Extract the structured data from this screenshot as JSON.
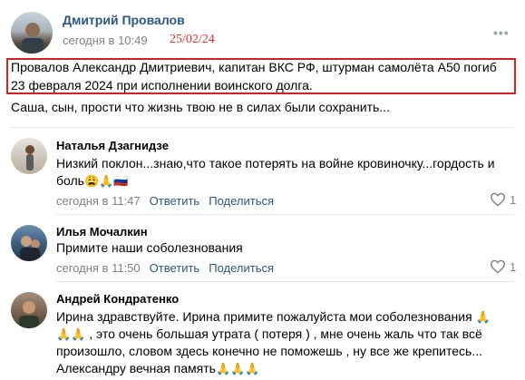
{
  "post": {
    "author": "Дмитрий Провалов",
    "date": "сегодня в 10:49",
    "stamp": "25/02/24",
    "more": "•••",
    "text_line1": "Провалов Александр Дмитриевич, капитан ВКС РФ, штурман самолёта А50 погиб",
    "text_line2": "23 февраля 2024 при исполнении воинского долга.",
    "text_line3": "Саша, сын, прости что жизнь твою не в силах были сохранить..."
  },
  "comments": [
    {
      "author": "Наталья Дзагнидзе",
      "text_line1": "Низкий поклон...знаю,что такое потерять на войне кровиночку...гордость и",
      "text_line2": "боль",
      "emojis": "😩🙏🇷🇺",
      "date": "сегодня в 11:47",
      "reply": "Ответить",
      "share": "Поделиться",
      "likes": "1"
    },
    {
      "author": "Илья Мочалкин",
      "text_line1": "Примите наши соболезнования",
      "date": "сегодня в 11:50",
      "reply": "Ответить",
      "share": "Поделиться",
      "likes": "1"
    },
    {
      "author": "Андрей Кондратенко",
      "text_line1": "Ирина здравствуйте. Ирина примите пожалуйста мои соболезнования",
      "emoji1": "🙏",
      "emoji2": "🙏🙏",
      "text_line2": ", это очень большая утрата ( потеря ) , мне очень жаль что так всё",
      "text_line3": "произошло, словом здесь конечно не поможешь , ну все же крепитесь...",
      "text_line4": "Александру вечная память",
      "emoji3": "🙏🙏🙏"
    }
  ],
  "colors": {
    "link": "#2a5885",
    "meta": "#828282",
    "highlight": "#d81d25",
    "stamp": "#e8302a"
  }
}
